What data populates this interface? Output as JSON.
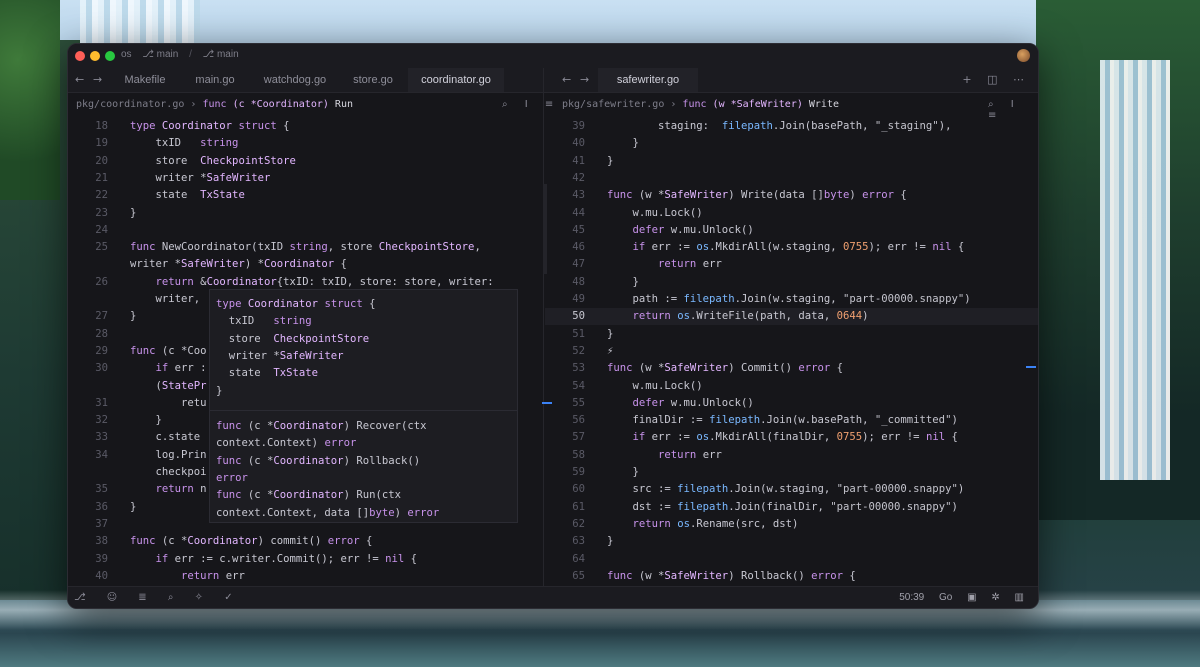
{
  "window": {
    "repo": "os",
    "branch_label_1": "⎇ main",
    "branch_label_2": "⎇ main"
  },
  "left_tabs": {
    "back": "←",
    "forward": "→",
    "items": [
      "Makefile",
      "main.go",
      "watchdog.go",
      "store.go",
      "coordinator.go"
    ],
    "active": "coordinator.go"
  },
  "right_tabs": {
    "back": "←",
    "forward": "→",
    "items": [
      "safewriter.go"
    ],
    "active": "safewriter.go",
    "icons": "+ ◫ ⋯"
  },
  "left_breadcrumb": {
    "path": "pkg/coordinator.go",
    "sep": " › ",
    "kw": "func",
    "recv": "(c *Coordinator)",
    "fn": "Run"
  },
  "right_breadcrumb": {
    "path": "pkg/safewriter.go",
    "sep": " › ",
    "kw": "func",
    "recv": "(w *SafeWriter)",
    "fn": "Write"
  },
  "breadcrumb_icons": "⌕ I ≡",
  "left_code": [
    {
      "n": "18",
      "t": "type Coordinator struct {"
    },
    {
      "n": "19",
      "t": "    txID   string"
    },
    {
      "n": "20",
      "t": "    store  CheckpointStore"
    },
    {
      "n": "21",
      "t": "    writer *SafeWriter"
    },
    {
      "n": "22",
      "t": "    state  TxState"
    },
    {
      "n": "23",
      "t": "}"
    },
    {
      "n": "24",
      "t": ""
    },
    {
      "n": "25",
      "t": "func NewCoordinator(txID string, store CheckpointStore,"
    },
    {
      "n": "",
      "t": "writer *SafeWriter) *Coordinator {"
    },
    {
      "n": "26",
      "t": "    return &Coordinator{txID: txID, store: store, writer:"
    },
    {
      "n": "",
      "t": "    writer,"
    },
    {
      "n": "27",
      "t": "}"
    },
    {
      "n": "28",
      "t": ""
    },
    {
      "n": "29",
      "t": "func (c *Coo"
    },
    {
      "n": "30",
      "t": "    if err :                                       g"
    },
    {
      "n": "",
      "t": "    (StatePr"
    },
    {
      "n": "31",
      "t": "        retu"
    },
    {
      "n": "32",
      "t": "    }"
    },
    {
      "n": "33",
      "t": "    c.state"
    },
    {
      "n": "34",
      "t": "    log.Prin                                       e"
    },
    {
      "n": "",
      "t": "    checkpoi"
    },
    {
      "n": "35",
      "t": "    return n"
    },
    {
      "n": "36",
      "t": "}"
    },
    {
      "n": "37",
      "t": ""
    },
    {
      "n": "38",
      "t": "func (c *Coordinator) commit() error {"
    },
    {
      "n": "39",
      "t": "    if err := c.writer.Commit(); err != nil {"
    },
    {
      "n": "40",
      "t": "        return err"
    }
  ],
  "hover": {
    "def": [
      "type Coordinator struct {",
      "  txID   string",
      "  store  CheckpointStore",
      "  writer *SafeWriter",
      "  state  TxState",
      "}"
    ],
    "methods": [
      "func (c *Coordinator) Recover(ctx",
      "context.Context) error",
      "func (c *Coordinator) Rollback()",
      "error",
      "func (c *Coordinator) Run(ctx",
      "context.Context, data []byte) error"
    ]
  },
  "right_code": [
    {
      "n": "39",
      "t": "        staging:  filepath.Join(basePath, \"_staging\"),"
    },
    {
      "n": "40",
      "t": "    }"
    },
    {
      "n": "41",
      "t": "}"
    },
    {
      "n": "42",
      "t": ""
    },
    {
      "n": "43",
      "t": "func (w *SafeWriter) Write(data []byte) error {"
    },
    {
      "n": "44",
      "t": "    w.mu.Lock()"
    },
    {
      "n": "45",
      "t": "    defer w.mu.Unlock()"
    },
    {
      "n": "46",
      "t": "    if err := os.MkdirAll(w.staging, 0755); err != nil {"
    },
    {
      "n": "47",
      "t": "        return err"
    },
    {
      "n": "48",
      "t": "    }"
    },
    {
      "n": "49",
      "t": "    path := filepath.Join(w.staging, \"part-00000.snappy\")"
    },
    {
      "n": "50",
      "t": "    return os.WriteFile(path, data, 0644)"
    },
    {
      "n": "51",
      "t": "}"
    },
    {
      "n": "52",
      "t": "⚡"
    },
    {
      "n": "53",
      "t": "func (w *SafeWriter) Commit() error {"
    },
    {
      "n": "54",
      "t": "    w.mu.Lock()"
    },
    {
      "n": "55",
      "t": "    defer w.mu.Unlock()"
    },
    {
      "n": "56",
      "t": "    finalDir := filepath.Join(w.basePath, \"_committed\")"
    },
    {
      "n": "57",
      "t": "    if err := os.MkdirAll(finalDir, 0755); err != nil {"
    },
    {
      "n": "58",
      "t": "        return err"
    },
    {
      "n": "59",
      "t": "    }"
    },
    {
      "n": "60",
      "t": "    src := filepath.Join(w.staging, \"part-00000.snappy\")"
    },
    {
      "n": "61",
      "t": "    dst := filepath.Join(finalDir, \"part-00000.snappy\")"
    },
    {
      "n": "62",
      "t": "    return os.Rename(src, dst)"
    },
    {
      "n": "63",
      "t": "}"
    },
    {
      "n": "64",
      "t": ""
    },
    {
      "n": "65",
      "t": "func (w *SafeWriter) Rollback() error {"
    }
  ],
  "status": {
    "left_icons": "⎇ ☺ ≣ ⌕ ✧ ✓",
    "position": "50:39",
    "language": "Go",
    "right_icons": "▣ ✲ ▥"
  },
  "colors": {
    "accent": "#3b82f6",
    "keyword": "#c792ea",
    "function": "#e8b878",
    "number": "#f0a070"
  }
}
